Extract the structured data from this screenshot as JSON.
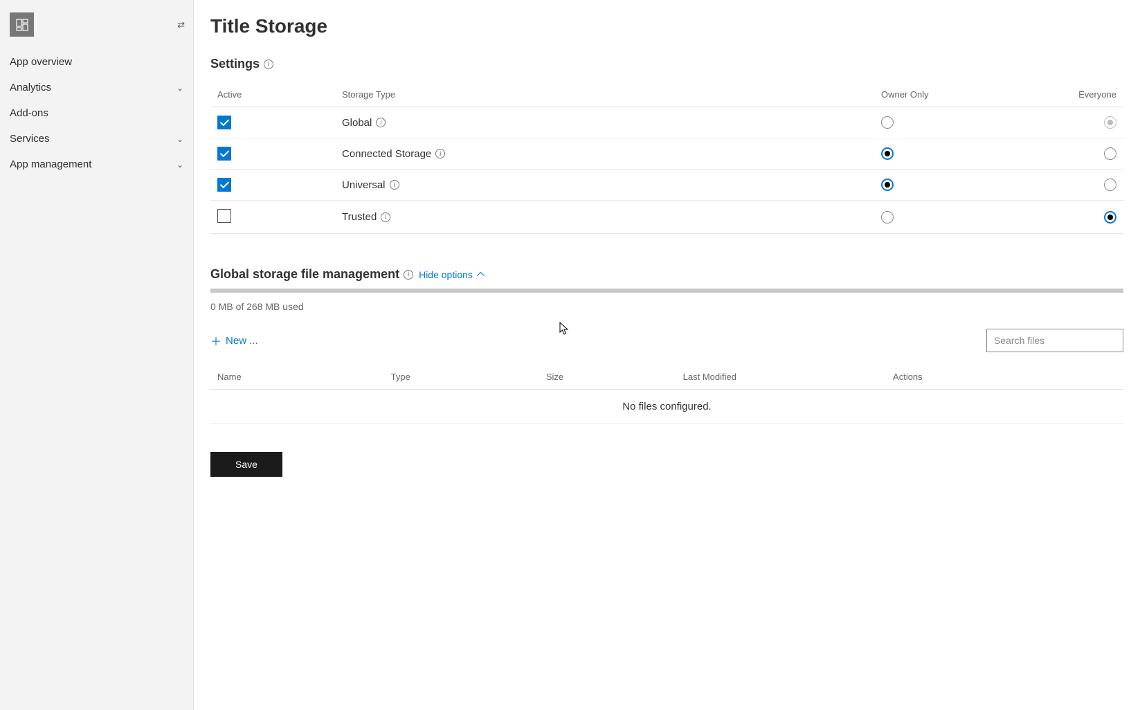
{
  "sidebar": {
    "items": [
      {
        "label": "App overview",
        "expandable": false
      },
      {
        "label": "Analytics",
        "expandable": true
      },
      {
        "label": "Add-ons",
        "expandable": false
      },
      {
        "label": "Services",
        "expandable": true
      },
      {
        "label": "App management",
        "expandable": true
      }
    ]
  },
  "page": {
    "title": "Title Storage"
  },
  "settings": {
    "heading": "Settings",
    "columns": {
      "active": "Active",
      "storage_type": "Storage Type",
      "owner_only": "Owner Only",
      "everyone": "Everyone"
    },
    "rows": [
      {
        "type": "Global",
        "active": true,
        "owner_selected": false,
        "everyone_selected": true,
        "disabled": true
      },
      {
        "type": "Connected Storage",
        "active": true,
        "owner_selected": true,
        "everyone_selected": false,
        "disabled": false
      },
      {
        "type": "Universal",
        "active": true,
        "owner_selected": true,
        "everyone_selected": false,
        "disabled": false
      },
      {
        "type": "Trusted",
        "active": false,
        "owner_selected": false,
        "everyone_selected": true,
        "disabled": false
      }
    ]
  },
  "global_storage": {
    "heading": "Global storage file management",
    "toggle_label": "Hide options",
    "usage": "0 MB of 268 MB used",
    "new_label": "New ...",
    "search_placeholder": "Search files",
    "columns": {
      "name": "Name",
      "type": "Type",
      "size": "Size",
      "last_modified": "Last Modified",
      "actions": "Actions"
    },
    "empty_message": "No files configured."
  },
  "actions": {
    "save": "Save"
  }
}
